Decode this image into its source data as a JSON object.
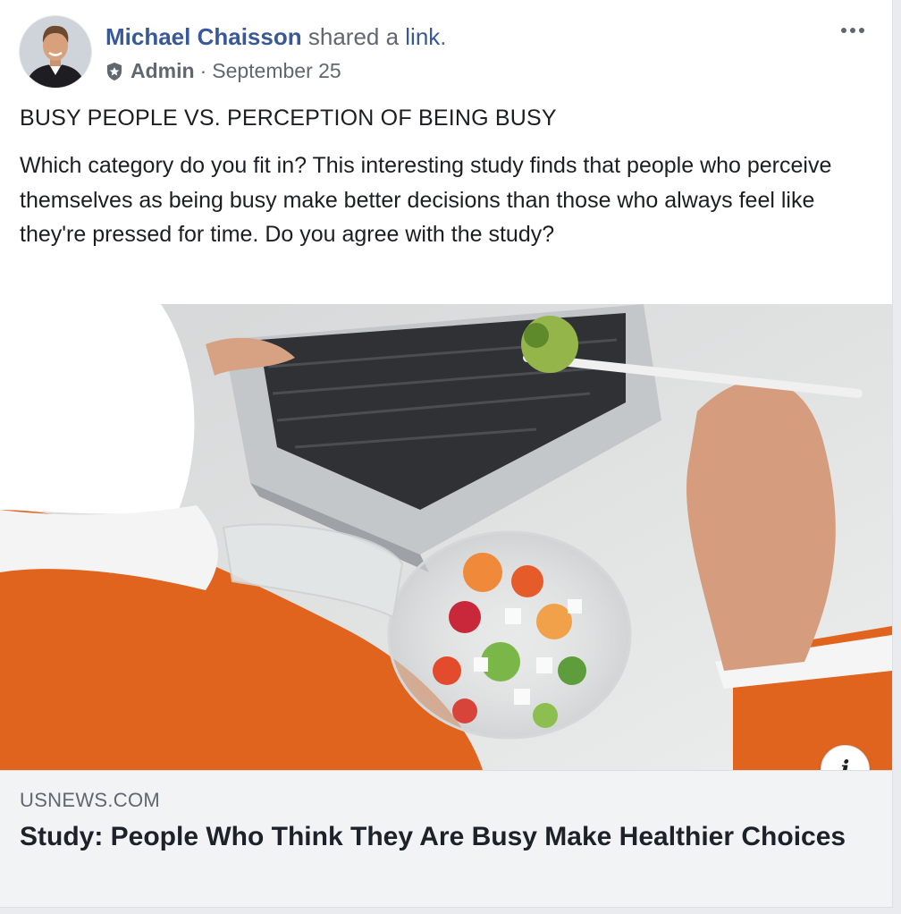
{
  "post": {
    "author": "Michael Chaisson",
    "action_prefix": "shared a",
    "action_link": "link",
    "action_suffix": ".",
    "role": "Admin",
    "separator": "·",
    "date": "September 25",
    "headline": "BUSY PEOPLE VS. PERCEPTION OF BEING BUSY",
    "body": "Which category do you fit in? This interesting study finds that people who perceive themselves as being busy make better decisions than those who always feel like they're pressed for time. Do you agree with the study?"
  },
  "link_preview": {
    "domain": "USNEWS.COM",
    "title": "Study: People Who Think They Are Busy Make Healthier Choices",
    "info_icon_glyph": "i"
  },
  "icons": {
    "more": "more-options-icon",
    "admin_badge": "shield-icon",
    "info": "info-icon"
  },
  "colors": {
    "link_blue": "#385898",
    "meta_gray": "#616770",
    "footer_bg": "#f2f3f5",
    "sweater_orange": "#e0641d"
  }
}
